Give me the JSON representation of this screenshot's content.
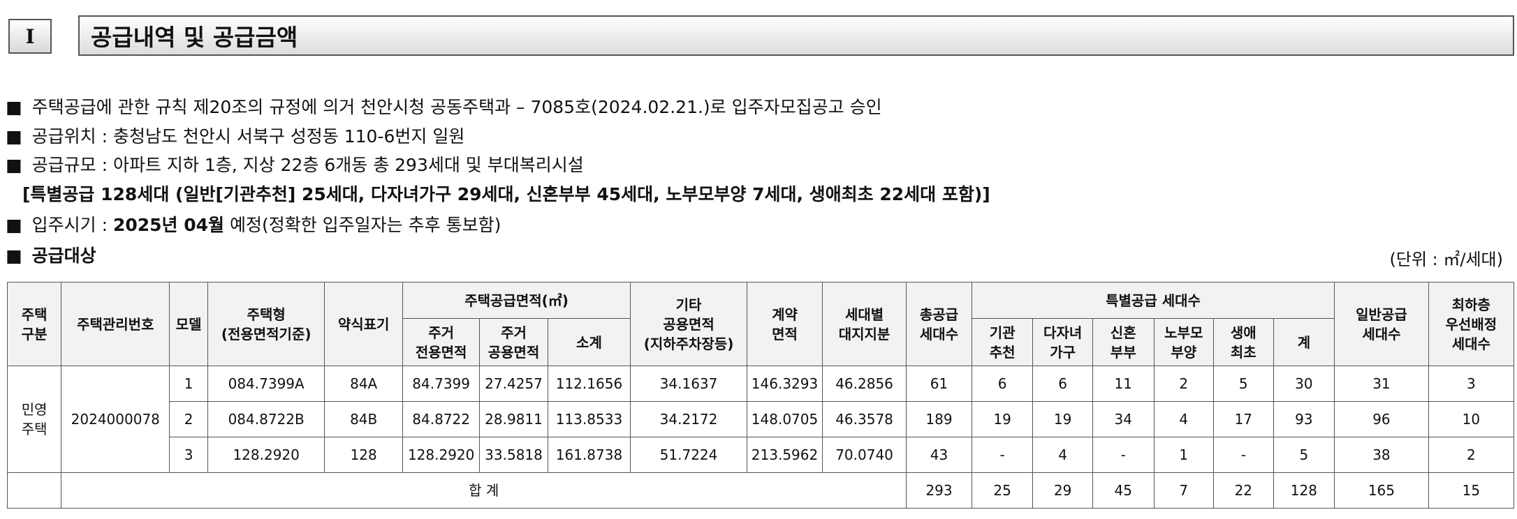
{
  "section": {
    "number": "I",
    "title": "공급내역 및 공급금액"
  },
  "bullets": {
    "b1": "주택공급에 관한 규칙 제20조의 규정에 의거 천안시청 공동주택과 – 7085호(2024.02.21.)로 입주자모집공고 승인",
    "b2": "공급위치 : 충청남도 천안시 서북구 성정동 110-6번지 일원",
    "b3": "공급규모 : 아파트 지하 1층, 지상 22층 6개동 총 293세대 및 부대복리시설",
    "b3_sub": "[특별공급 128세대 (일반[기관추천] 25세대, 다자녀가구 29세대, 신혼부부 45세대, 노부모부양 7세대, 생애최초 22세대 포함)]",
    "b4_pre": "입주시기 : ",
    "b4_bold": "2025년 04월",
    "b4_post": " 예정(정확한 입주일자는 추후 통보함)",
    "b5": "공급대상",
    "marker": "■"
  },
  "unit": "(단위 : ㎡/세대)",
  "table": {
    "headers": {
      "housing_type": "주택\n구분",
      "mgmt_no": "주택관리번호",
      "model": "모델",
      "house_type": "주택형\n(전용면적기준)",
      "abbr": "약식표기",
      "supply_area": "주택공급면적(㎡)",
      "excl_area": "주거\n전용면적",
      "common_area": "주거\n공용면적",
      "subtotal": "소계",
      "other_common": "기타\n공용면적\n(지하주차장등)",
      "contract_area": "계약\n면적",
      "land_share": "세대별\n대지지분",
      "total_units": "총공급\n세대수",
      "special": "특별공급 세대수",
      "sp_inst": "기관\n추천",
      "sp_multi": "다자녀\n가구",
      "sp_newly": "신혼\n부부",
      "sp_parent": "노부모\n부양",
      "sp_first": "생애\n최초",
      "sp_sum": "계",
      "general": "일반공급\n세대수",
      "lowest": "최하층\n우선배정\n세대수"
    },
    "group_label": "민영\n주택",
    "mgmt_no": "2024000078",
    "rows": [
      [
        "1",
        "084.7399A",
        "84A",
        "84.7399",
        "27.4257",
        "112.1656",
        "34.1637",
        "146.3293",
        "46.2856",
        "61",
        "6",
        "6",
        "11",
        "2",
        "5",
        "30",
        "31",
        "3"
      ],
      [
        "2",
        "084.8722B",
        "84B",
        "84.8722",
        "28.9811",
        "113.8533",
        "34.2172",
        "148.0705",
        "46.3578",
        "189",
        "19",
        "19",
        "34",
        "4",
        "17",
        "93",
        "96",
        "10"
      ],
      [
        "3",
        "128.2920",
        "128",
        "128.2920",
        "33.5818",
        "161.8738",
        "51.7224",
        "213.5962",
        "70.0740",
        "43",
        "-",
        "4",
        "-",
        "1",
        "-",
        "5",
        "38",
        "2"
      ]
    ],
    "total_label": "합 계",
    "totals": [
      "293",
      "25",
      "29",
      "45",
      "7",
      "22",
      "128",
      "165",
      "15"
    ]
  }
}
